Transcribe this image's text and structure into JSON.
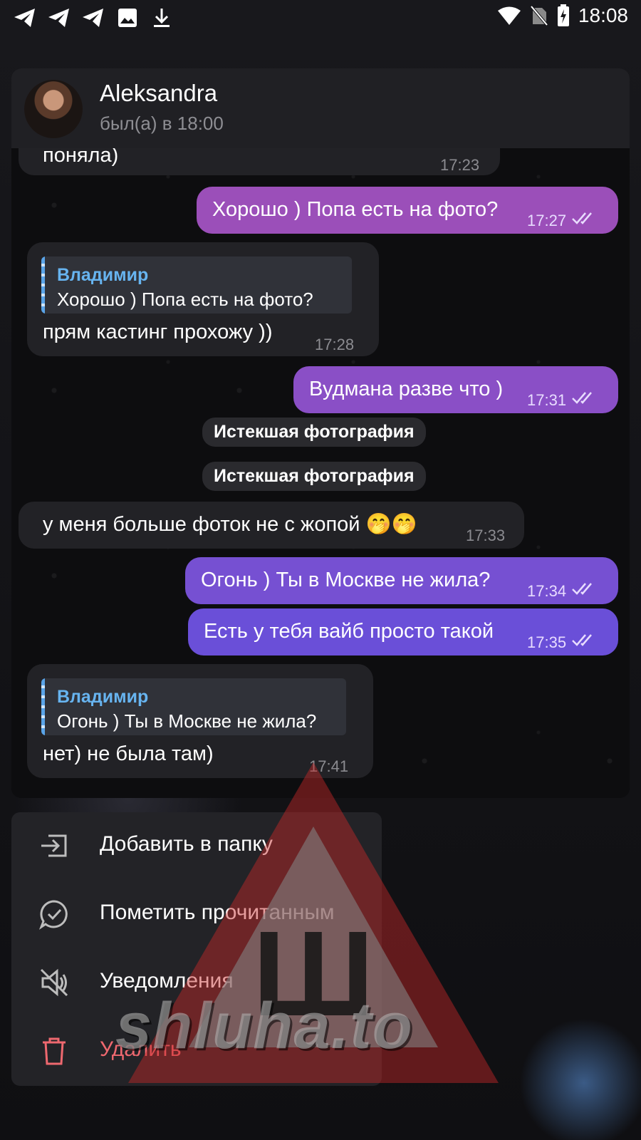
{
  "status_bar": {
    "time": "18:08",
    "left_icons": [
      "telegram-icon",
      "telegram-icon",
      "telegram-icon",
      "image-icon",
      "download-icon"
    ],
    "right_icons": [
      "wifi-icon",
      "no-sim-icon",
      "battery-charging-icon"
    ]
  },
  "header": {
    "name": "Aleksandra",
    "status": "был(а) в 18:00"
  },
  "messages": [
    {
      "text": "поняла)",
      "time": "17:23"
    },
    {
      "text": "Хорошо ) Попа есть на фото?",
      "time": "17:27"
    },
    {
      "reply_name": "Владимир",
      "reply_text": "Хорошо ) Попа есть на фото?",
      "text": "прям кастинг прохожу ))",
      "time": "17:28"
    },
    {
      "text": "Вудмана разве что )",
      "time": "17:31"
    },
    {
      "service": "Истекшая фотография"
    },
    {
      "service": "Истекшая фотография"
    },
    {
      "text": "у меня больше фоток не с жопой 🤭🤭",
      "time": "17:33"
    },
    {
      "text": "Огонь ) Ты в Москве не жила?",
      "time": "17:34"
    },
    {
      "text": "Есть у тебя вайб просто такой",
      "time": "17:35"
    },
    {
      "reply_name": "Владимир",
      "reply_text": "Огонь ) Ты в Москве не жила?",
      "text": "нет) не была там)",
      "time": "17:41"
    }
  ],
  "menu": [
    {
      "label": "Добавить в папку",
      "icon": "folder-move-icon"
    },
    {
      "label": "Пометить прочитанным",
      "icon": "chat-check-icon"
    },
    {
      "label": "Уведомления",
      "icon": "mute-icon"
    },
    {
      "label": "Удалить",
      "icon": "trash-icon",
      "color": "#ee686f"
    }
  ],
  "watermark": {
    "text": "shluha.to",
    "glyph": "Ш"
  },
  "colors": {
    "outgoing_top": "#a04fb7",
    "outgoing_bottom": "#6a4fd8",
    "incoming": "#222226",
    "reply_name": "#67b4f0",
    "danger": "#ee686f"
  }
}
